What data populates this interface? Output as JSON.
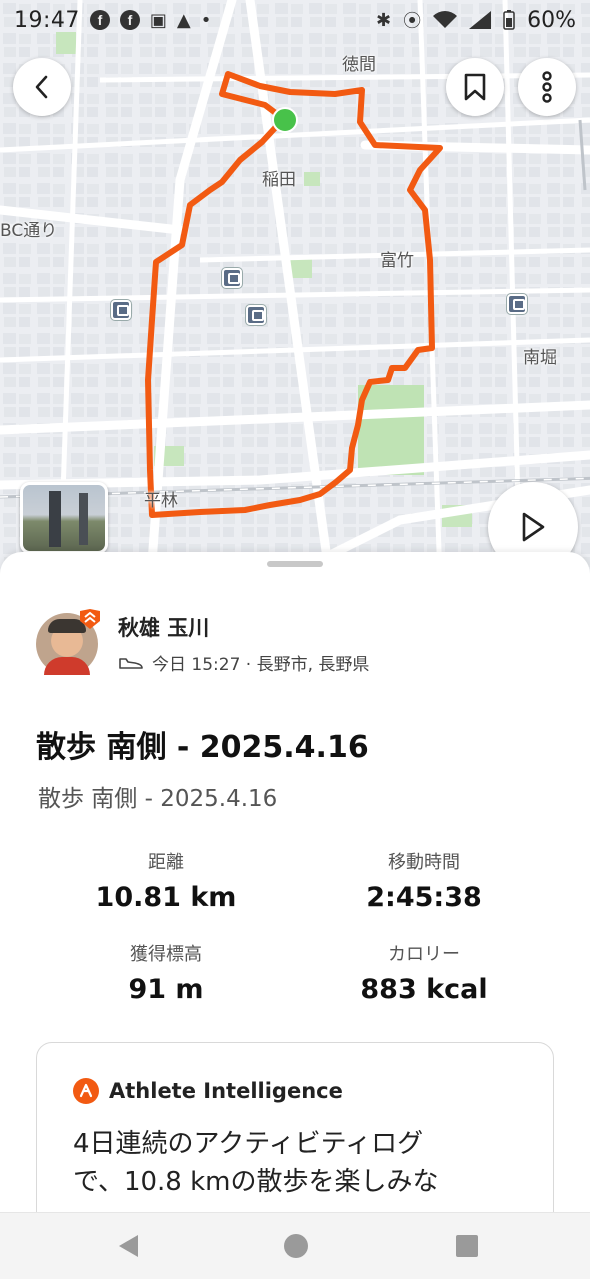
{
  "status_bar": {
    "time": "19:47",
    "battery": "60%"
  },
  "map": {
    "place_labels": [
      "徳間",
      "稲田",
      "富竹",
      "南堀",
      "平林",
      "BC通り"
    ],
    "route_color": "#f25a12",
    "start_marker_color": "#48c24a"
  },
  "athlete": {
    "name": "秋雄 玉川",
    "meta": "今日 15:27 · 長野市, 長野県"
  },
  "activity": {
    "title": "散歩 南側 - 2025.4.16",
    "subtitle": "散歩 南側 - 2025.4.16"
  },
  "stats": {
    "distance_label": "距離",
    "distance_value": "10.81 km",
    "moving_time_label": "移動時間",
    "moving_time_value": "2:45:38",
    "elevation_label": "獲得標高",
    "elevation_value": "91 m",
    "calories_label": "カロリー",
    "calories_value": "883 kcal"
  },
  "athlete_intelligence": {
    "title": "Athlete Intelligence",
    "text_line1": "4日連続のアクティビティログ",
    "text_line2": "で、10.8 kmの散歩を楽しみな"
  },
  "icons": {
    "back": "chevron-left-icon",
    "bookmark": "bookmark-icon",
    "more": "more-vertical-icon",
    "play": "play-icon"
  }
}
